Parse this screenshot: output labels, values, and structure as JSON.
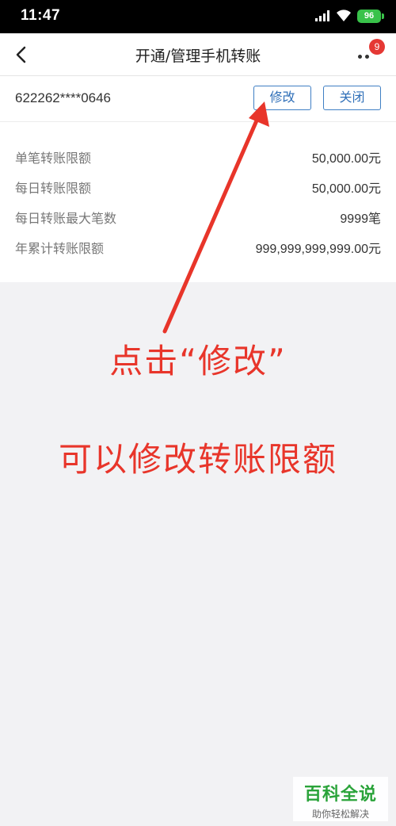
{
  "status_bar": {
    "time": "11:47",
    "battery": "96",
    "icons": [
      "signal-icon",
      "wifi-icon",
      "battery-icon"
    ]
  },
  "nav": {
    "title": "开通/管理手机转账",
    "badge": "9",
    "icons": [
      "back-arrow-icon",
      "more-dots-icon"
    ]
  },
  "account": {
    "number": "622262****0646",
    "modify_label": "修改",
    "close_label": "关闭"
  },
  "limits": [
    {
      "label": "单笔转账限额",
      "value": "50,000.00元"
    },
    {
      "label": "每日转账限额",
      "value": "50,000.00元"
    },
    {
      "label": "每日转账最大笔数",
      "value": "9999笔"
    },
    {
      "label": "年累计转账限额",
      "value": "999,999,999,999.00元"
    }
  ],
  "annotation": {
    "line1": "点击“修改”",
    "line2": "可以修改转账限额",
    "color": "#e8352a"
  },
  "watermark": {
    "title": "百科全说",
    "subtitle": "助你轻松解决"
  },
  "colors": {
    "accent": "#2f6fb8",
    "badge": "#e53834",
    "battery": "#39c24a"
  }
}
